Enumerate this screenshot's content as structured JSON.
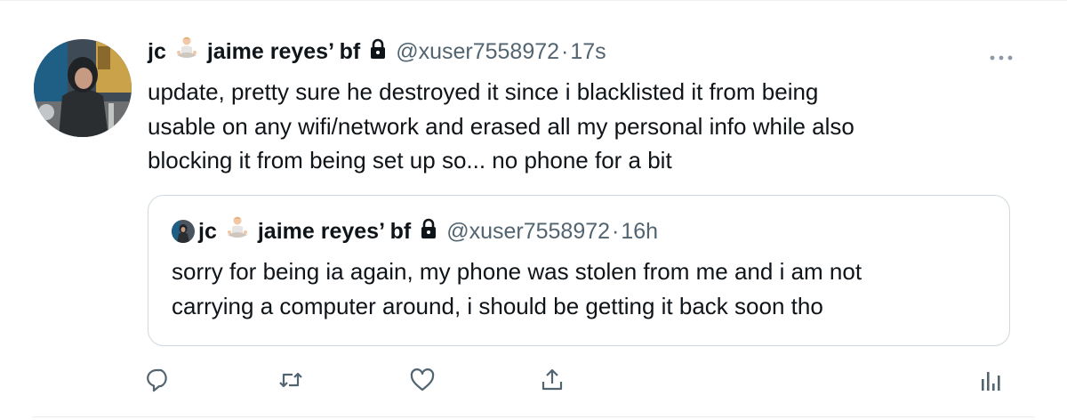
{
  "tweet": {
    "author": {
      "name_prefix": "jc",
      "name_emoji": "person-in-lotus-position-emoji",
      "name_suffix": "jaime reyes’ bf",
      "locked": true,
      "handle": "@xuser7558972",
      "separator": "·",
      "timestamp": "17s"
    },
    "text_lines": [
      "update, pretty sure he destroyed it since i blacklisted it from being",
      "usable on any wifi/network and erased all my personal info while also",
      "blocking it from being set up so... no phone for a bit"
    ],
    "quoted": {
      "name_prefix": "jc",
      "name_suffix": "jaime reyes’ bf",
      "locked": true,
      "handle": "@xuser7558972",
      "separator": "·",
      "timestamp": "16h",
      "text_lines": [
        "sorry for being ia again, my phone was stolen from me and i am not",
        "carrying a computer around, i should be getting it back soon tho"
      ]
    },
    "actions": {
      "reply_icon": "reply-icon",
      "retweet_icon": "retweet-icon",
      "like_icon": "like-icon",
      "share_icon": "share-icon",
      "analytics_icon": "analytics-icon"
    },
    "colors": {
      "text": "#0f1419",
      "secondary": "#536471",
      "border": "#cfd9de",
      "icon": "#536471"
    }
  }
}
